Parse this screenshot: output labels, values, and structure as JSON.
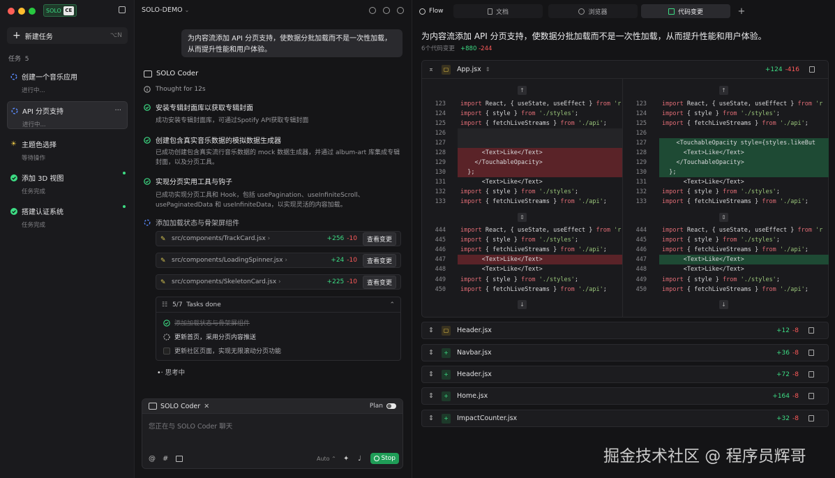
{
  "app": {
    "logo_text": "SOLO",
    "logo_box": "CE"
  },
  "sidebar": {
    "new_task": "新建任务",
    "new_task_shortcut": "⌥N",
    "section_label": "任务",
    "task_count": "5",
    "tasks": [
      {
        "title": "创建一个音乐应用",
        "status": "进行中..."
      },
      {
        "title": "API 分页支持",
        "status": "进行中..."
      },
      {
        "title": "主题色选择",
        "status": "等待操作"
      },
      {
        "title": "添加 3D 视图",
        "status": "任务完成"
      },
      {
        "title": "搭建认证系统",
        "status": "任务完成"
      }
    ]
  },
  "chat": {
    "project": "SOLO-DEMO",
    "user_message": "为内容流添加 API 分页支持，使数据分批加载而不是一次性加载，从而提升性能和用户体验。",
    "agent": "SOLO Coder",
    "thought": "Thought for 12s",
    "steps": [
      {
        "title": "安装专辑封面库以获取专辑封面",
        "desc": "成功安装专辑封面库，可通过Spotify API获取专辑封面"
      },
      {
        "title": "创建包含真实音乐数据的模拟数据生成器",
        "desc": "已成功创建包含真实流行音乐数据的 mock 数据生成器，并通过 album-art 库集成专辑封面，以及分页工具。"
      },
      {
        "title": "实现分页实用工具与钩子",
        "desc": "已成功实现分页工具和 Hook，包括 usePagination、useInfiniteScroll、usePaginatedData 和 useInfiniteData，以实现灵活的内容加载。"
      }
    ],
    "current_step": "添加加载状态与骨架屏组件",
    "files": [
      {
        "path": "src/components/TrackCard.jsx",
        "add": "+256",
        "del": "-10",
        "btn": "查看变更"
      },
      {
        "path": "src/components/LoadingSpinner.jsx",
        "add": "+24",
        "del": "-10",
        "btn": "查看变更"
      },
      {
        "path": "src/components/SkeletonCard.jsx",
        "add": "+225",
        "del": "-10",
        "btn": "查看变更"
      }
    ],
    "todos": {
      "count": "5/7",
      "label": "Tasks done",
      "items": [
        "添加加载状态与骨架屏组件",
        "更新首页，采用分页内容推送",
        "更新社区页面，实现无限滚动分页功能"
      ]
    },
    "thinking": "思考中",
    "composer": {
      "agent": "SOLO Coder",
      "plan": "Plan",
      "placeholder": "您正在与 SOLO Coder 聊天",
      "auto": "Auto",
      "stop": "Stop"
    }
  },
  "right": {
    "tabs": [
      "Flow",
      "文档",
      "浏览器",
      "代码变更"
    ],
    "title": "为内容流添加 API 分页支持，使数据分批加载而不是一次性加载，从而提升性能和用户体验。",
    "changes_label": "6个代码变更",
    "total_add": "+880",
    "total_del": "-244",
    "main_file": {
      "name": "App.jsx",
      "add": "+124",
      "del": "-416"
    },
    "left_lines": [
      {
        "n": "123",
        "c": "import React, { useState, useEffect } from 'r"
      },
      {
        "n": "124",
        "c": "import { style } from './styles';"
      },
      {
        "n": "125",
        "c": "import { fetchLiveStreams } from './api';"
      },
      {
        "n": "126",
        "c": ""
      },
      {
        "n": "127",
        "c": ""
      },
      {
        "n": "128",
        "c": "      <Text>Like</Text>"
      },
      {
        "n": "129",
        "c": "    </TouchableOpacity>"
      },
      {
        "n": "130",
        "c": "  };"
      },
      {
        "n": "131",
        "c": "      <Text>Like</Text>"
      },
      {
        "n": "132",
        "c": "import { style } from './styles';"
      },
      {
        "n": "133",
        "c": "import { fetchLiveStreams } from './api';"
      },
      {
        "n": "444",
        "c": "import React, { useState, useEffect } from 'r"
      },
      {
        "n": "445",
        "c": "import { style } from './styles';"
      },
      {
        "n": "446",
        "c": "import { fetchLiveStreams } from './api';"
      },
      {
        "n": "447",
        "c": "      <Text>Like</Text>"
      },
      {
        "n": "448",
        "c": "      <Text>Like</Text>"
      },
      {
        "n": "449",
        "c": "import { style } from './styles';"
      },
      {
        "n": "450",
        "c": "import { fetchLiveStreams } from './api';"
      }
    ],
    "right_lines": [
      {
        "n": "123",
        "c": "import React, { useState, useEffect } from 'r"
      },
      {
        "n": "124",
        "c": "import { style } from './styles';"
      },
      {
        "n": "125",
        "c": "import { fetchLiveStreams } from './api';"
      },
      {
        "n": "126",
        "c": ""
      },
      {
        "n": "127",
        "c": "    <TouchableOpacity style={styles.likeBut"
      },
      {
        "n": "128",
        "c": "      <Text>Like</Text>"
      },
      {
        "n": "129",
        "c": "    </TouchableOpacity>"
      },
      {
        "n": "130",
        "c": "  };"
      },
      {
        "n": "131",
        "c": "      <Text>Like</Text>"
      },
      {
        "n": "132",
        "c": "import { style } from './styles';"
      },
      {
        "n": "133",
        "c": "import { fetchLiveStreams } from './api';"
      },
      {
        "n": "444",
        "c": "import React, { useState, useEffect } from 'r"
      },
      {
        "n": "445",
        "c": "import { style } from './styles';"
      },
      {
        "n": "446",
        "c": "import { fetchLiveStreams } from './api';"
      },
      {
        "n": "447",
        "c": "      <Text>Like</Text>"
      },
      {
        "n": "448",
        "c": "      <Text>Like</Text>"
      },
      {
        "n": "449",
        "c": "import { style } from './styles';"
      },
      {
        "n": "450",
        "c": "import { fetchLiveStreams } from './api';"
      }
    ],
    "other_files": [
      {
        "name": "Header.jsx",
        "add": "+12",
        "del": "-8"
      },
      {
        "name": "Navbar.jsx",
        "add": "+36",
        "del": "-8"
      },
      {
        "name": "Header.jsx",
        "add": "+72",
        "del": "-8"
      },
      {
        "name": "Home.jsx",
        "add": "+164",
        "del": "-8"
      },
      {
        "name": "ImpactCounter.jsx",
        "add": "+32",
        "del": "-8"
      }
    ]
  },
  "watermark": "掘金技术社区 @ 程序员辉哥"
}
